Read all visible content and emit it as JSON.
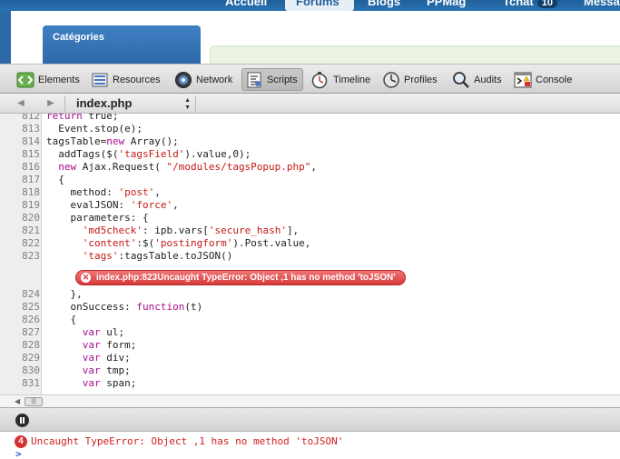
{
  "site": {
    "nav": [
      "Accueil",
      "Forums",
      "Blogs",
      "PPMag",
      "Tchat",
      "Messa"
    ],
    "tchat_badge": "10",
    "sidebar_title": "Catégories"
  },
  "toolbar": {
    "items": [
      "Elements",
      "Resources",
      "Network",
      "Scripts",
      "Timeline",
      "Profiles",
      "Audits",
      "Console"
    ],
    "active": "Scripts"
  },
  "filebar": {
    "back_arrow": "◀",
    "forward_arrow": "▶",
    "file": "index.php"
  },
  "code": {
    "lines": [
      {
        "n": "812",
        "html": "<span class=\"kw\">return</span> true;"
      },
      {
        "n": "813",
        "html": "  Event.stop(e);"
      },
      {
        "n": "814",
        "html": "tagsTable=<span class=\"kw\">new</span> Array();"
      },
      {
        "n": "815",
        "html": "  addTags($(<span class=\"str\">'tagsField'</span>).value,0);"
      },
      {
        "n": "816",
        "html": "  <span class=\"kw\">new</span> Ajax.Request( <span class=\"str\">\"/modules/tagsPopup.php\"</span>,"
      },
      {
        "n": "817",
        "html": "  {"
      },
      {
        "n": "818",
        "html": "    method: <span class=\"str\">'post'</span>,"
      },
      {
        "n": "819",
        "html": "    evalJSON: <span class=\"str\">'force'</span>,"
      },
      {
        "n": "820",
        "html": "    parameters: {"
      },
      {
        "n": "821",
        "html": "      <span class=\"str\">'md5check'</span>: ipb.vars[<span class=\"str\">'secure_hash'</span>],"
      },
      {
        "n": "822",
        "html": "      <span class=\"str\">'content'</span>:$(<span class=\"str\">'postingform'</span>).Post.value,"
      },
      {
        "n": "823",
        "html": "      <span class=\"str\">'tags'</span>:tagsTable.toJSON()"
      },
      {
        "n": "824",
        "html": "    },"
      },
      {
        "n": "825",
        "html": "    onSuccess: <span class=\"kw\">function</span>(t)"
      },
      {
        "n": "826",
        "html": "    {"
      },
      {
        "n": "827",
        "html": "      <span class=\"kw\">var</span> ul;"
      },
      {
        "n": "828",
        "html": "      <span class=\"kw\">var</span> form;"
      },
      {
        "n": "829",
        "html": "      <span class=\"kw\">var</span> div;"
      },
      {
        "n": "830",
        "html": "      <span class=\"kw\">var</span> tmp;"
      },
      {
        "n": "831",
        "html": "      <span class=\"kw\">var</span> span;"
      }
    ],
    "inline_error": "index.php:823Uncaught TypeError: Object ,1 has no method 'toJSON'"
  },
  "console": {
    "error_count": "4",
    "error_message": "Uncaught TypeError: Object ,1 has no method 'toJSON'",
    "prompt": ">"
  },
  "colors": {
    "error_red": "#d63232",
    "keyword": "#aa0d91",
    "string": "#c41a16"
  }
}
